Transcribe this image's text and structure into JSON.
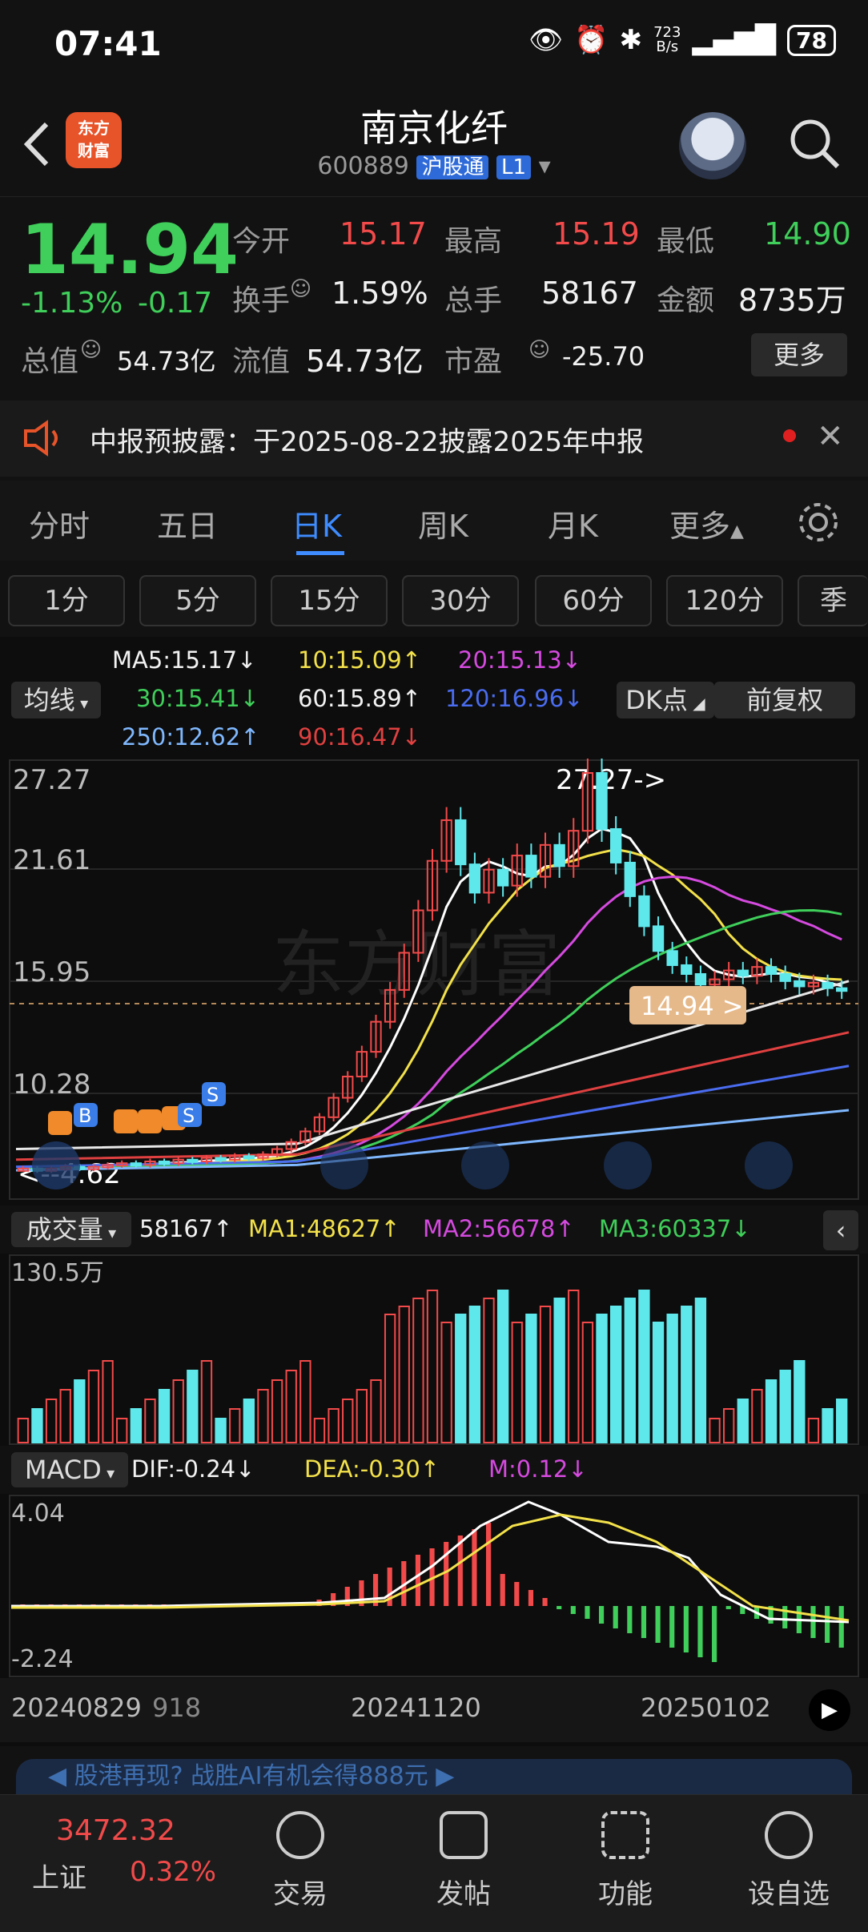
{
  "status": {
    "time": "07:41",
    "netspeed": "723\nB/s",
    "battery": "78"
  },
  "header": {
    "title": "南京化纤",
    "code": "600889",
    "tag": "沪股通",
    "level": "L1",
    "logo": "东方\n财富"
  },
  "quote": {
    "price": "14.94",
    "change_pct": "-1.13%",
    "change_abs": "-0.17",
    "open_label": "今开",
    "open": "15.17",
    "high_label": "最高",
    "high": "15.19",
    "low_label": "最低",
    "low": "14.90",
    "turnover_label": "换手",
    "turnover": "1.59%",
    "volume_label": "总手",
    "volume": "58167",
    "amount_label": "金额",
    "amount": "8735万",
    "mktcap_label": "总值",
    "mktcap": "54.73亿",
    "float_label": "流值",
    "float_cap": "54.73亿",
    "pe_label": "市盈",
    "pe": "-25.70",
    "more": "更多"
  },
  "notice": {
    "text": "中报预披露：于2025-08-22披露2025年中报"
  },
  "tabs": [
    "分时",
    "五日",
    "日K",
    "周K",
    "月K",
    "更多"
  ],
  "minutes": [
    "1分",
    "5分",
    "15分",
    "30分",
    "60分",
    "120分",
    "季"
  ],
  "ma": {
    "toggle": "均线",
    "ma5": "MA5:15.17↓",
    "ma10": "10:15.09↑",
    "ma20": "20:15.13↓",
    "ma30": "30:15.41↓",
    "ma60": "60:15.89↑",
    "ma120": "120:16.96↓",
    "ma250": "250:12.62↑",
    "ma90": "90:16.47↓",
    "dk": "DK点",
    "adjust": "前复权"
  },
  "chart": {
    "y_ticks": [
      "27.27",
      "21.61",
      "15.95",
      "10.28"
    ],
    "high_marker": "27.27->",
    "low_marker": "<--4.62",
    "price_tag": "14.94 >",
    "watermark": "东方财富"
  },
  "volume": {
    "toggle": "成交量",
    "current": "58167↑",
    "ma1": "MA1:48627↑",
    "ma2": "MA2:56678↑",
    "ma3": "MA3:60337↓",
    "max_tick": "130.5万"
  },
  "macd": {
    "toggle": "MACD",
    "dif": "DIF:-0.24↓",
    "dea": "DEA:-0.30↑",
    "m": "M:0.12↓",
    "max_tick": "4.04",
    "min_tick": "-2.24"
  },
  "dates": [
    "20240829",
    "918",
    "20241120",
    "20250102"
  ],
  "banner": "◀ 股港再现? 战胜AI有机会得888元 ▶",
  "bottom": {
    "index_value": "3472.32",
    "index_name": "上证",
    "index_change": "0.32%",
    "nav": [
      "交易",
      "发帖",
      "功能",
      "设自选"
    ]
  },
  "colors": {
    "up": "#f24a4a",
    "down": "#3fcf5a",
    "accent": "#3e8cff"
  },
  "chart_data": {
    "type": "candlestick",
    "title": "",
    "ylim": [
      4.62,
      27.27
    ],
    "series": [
      {
        "name": "MA5",
        "values": [
          15.17
        ]
      },
      {
        "name": "MA10",
        "values": [
          15.09
        ]
      },
      {
        "name": "MA20",
        "values": [
          15.13
        ]
      },
      {
        "name": "MA30",
        "values": [
          15.41
        ]
      },
      {
        "name": "MA60",
        "values": [
          15.89
        ]
      },
      {
        "name": "MA120",
        "values": [
          16.96
        ]
      },
      {
        "name": "MA250",
        "values": [
          12.62
        ]
      },
      {
        "name": "MA90",
        "values": [
          16.47
        ]
      }
    ],
    "close_series": [
      4.9,
      4.8,
      4.9,
      5.0,
      4.9,
      5.0,
      5.1,
      5.2,
      5.1,
      5.3,
      5.2,
      5.4,
      5.3,
      5.5,
      5.4,
      5.6,
      5.5,
      5.7,
      6.0,
      6.4,
      7.0,
      7.8,
      8.9,
      10.1,
      11.5,
      13.2,
      15.0,
      17.1,
      19.5,
      22.3,
      24.6,
      22.1,
      20.5,
      21.8,
      20.9,
      22.6,
      21.4,
      23.2,
      22.0,
      24.0,
      27.27,
      24.1,
      22.2,
      20.3,
      18.6,
      17.2,
      16.4,
      15.9,
      15.3,
      15.6,
      16.1,
      15.8,
      16.3,
      15.9,
      15.5,
      15.2,
      15.4,
      15.1,
      14.94
    ],
    "volume_ticks": {
      "max": "130.5万"
    },
    "macd_range": [
      -2.24,
      4.04
    ]
  }
}
